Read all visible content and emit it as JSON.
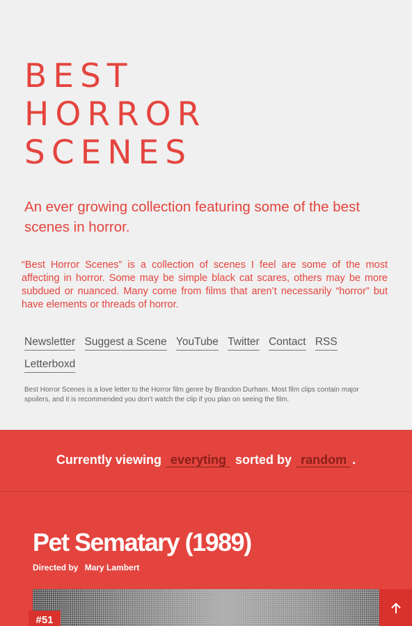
{
  "header": {
    "title_lines": [
      "BEST",
      "HORROR",
      "SCENES"
    ],
    "tagline": "An ever growing collection featuring some of the best scenes in horror.",
    "description": "“Best Horror Scenes” is a collection of scenes I feel are some of the most affecting in horror. Some may be simple black cat scares, others may be more subdued or nuanced. Many come from films that aren’t necessarily “horror” but have elements or threads of horror."
  },
  "nav": {
    "newsletter": "Newsletter",
    "suggest": "Suggest a Scene",
    "youtube": "YouTube",
    "twitter": "Twitter",
    "contact": "Contact",
    "rss": "RSS",
    "letterboxd": "Letterboxd"
  },
  "fineprint": "Best Horror Scenes is a love letter to the Horror film genre by Brandon Durham. Most film clips contain major spoilers, and it is recommended you don’t watch the clip if you plan on seeing the film.",
  "filter": {
    "prefix": "Currently viewing",
    "category": "everyting",
    "middle": "sorted by",
    "sort": "random",
    "suffix": "."
  },
  "scene": {
    "title": "Pet Sematary (1989)",
    "directed_label": "Directed by",
    "director": "Mary Lambert",
    "number": "#51"
  },
  "colors": {
    "accent": "#e4443e",
    "accent_dark": "#d9322c",
    "background": "#f0f0f0"
  },
  "icons": {
    "back_to_top": "arrow-up-icon"
  }
}
